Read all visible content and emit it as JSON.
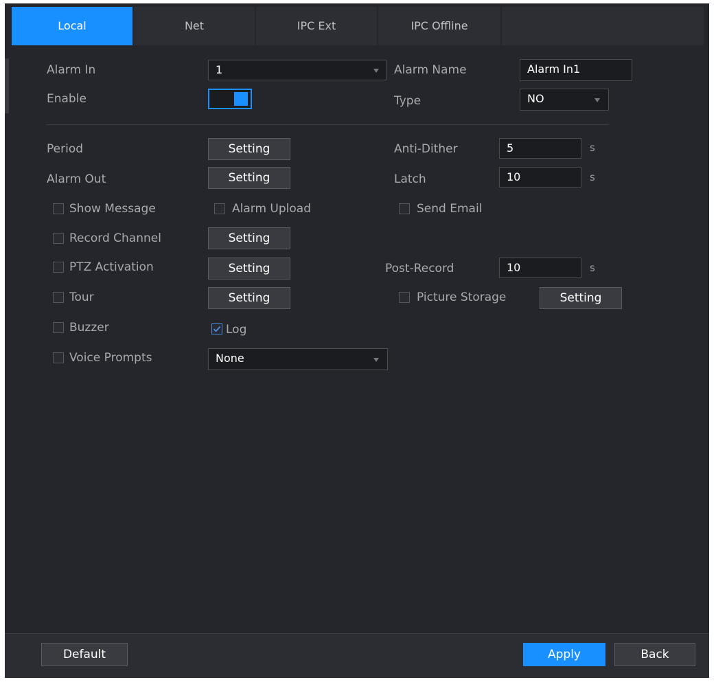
{
  "tabs": [
    {
      "label": "Local",
      "active": true
    },
    {
      "label": "Net",
      "active": false
    },
    {
      "label": "IPC Ext",
      "active": false
    },
    {
      "label": "IPC Offline",
      "active": false
    }
  ],
  "form": {
    "alarm_in_label": "Alarm In",
    "alarm_in_value": "1",
    "alarm_name_label": "Alarm Name",
    "alarm_name_value": "Alarm In1",
    "enable_label": "Enable",
    "enable_on": true,
    "type_label": "Type",
    "type_value": "NO",
    "period_label": "Period",
    "alarm_out_label": "Alarm Out",
    "anti_dither_label": "Anti-Dither",
    "anti_dither_value": "5",
    "latch_label": "Latch",
    "latch_value": "10",
    "post_record_label": "Post-Record",
    "post_record_value": "10",
    "unit_s": "s",
    "setting_label": "Setting",
    "show_message_label": "Show Message",
    "alarm_upload_label": "Alarm Upload",
    "send_email_label": "Send Email",
    "record_channel_label": "Record Channel",
    "ptz_activation_label": "PTZ Activation",
    "tour_label": "Tour",
    "picture_storage_label": "Picture Storage",
    "buzzer_label": "Buzzer",
    "log_label": "Log",
    "log_checked": true,
    "voice_prompts_label": "Voice Prompts",
    "voice_prompts_value": "None"
  },
  "footer": {
    "default_label": "Default",
    "apply_label": "Apply",
    "back_label": "Back"
  },
  "colors": {
    "accent": "#1890ff",
    "background": "#25262b",
    "label_text": "#a9aaae"
  }
}
